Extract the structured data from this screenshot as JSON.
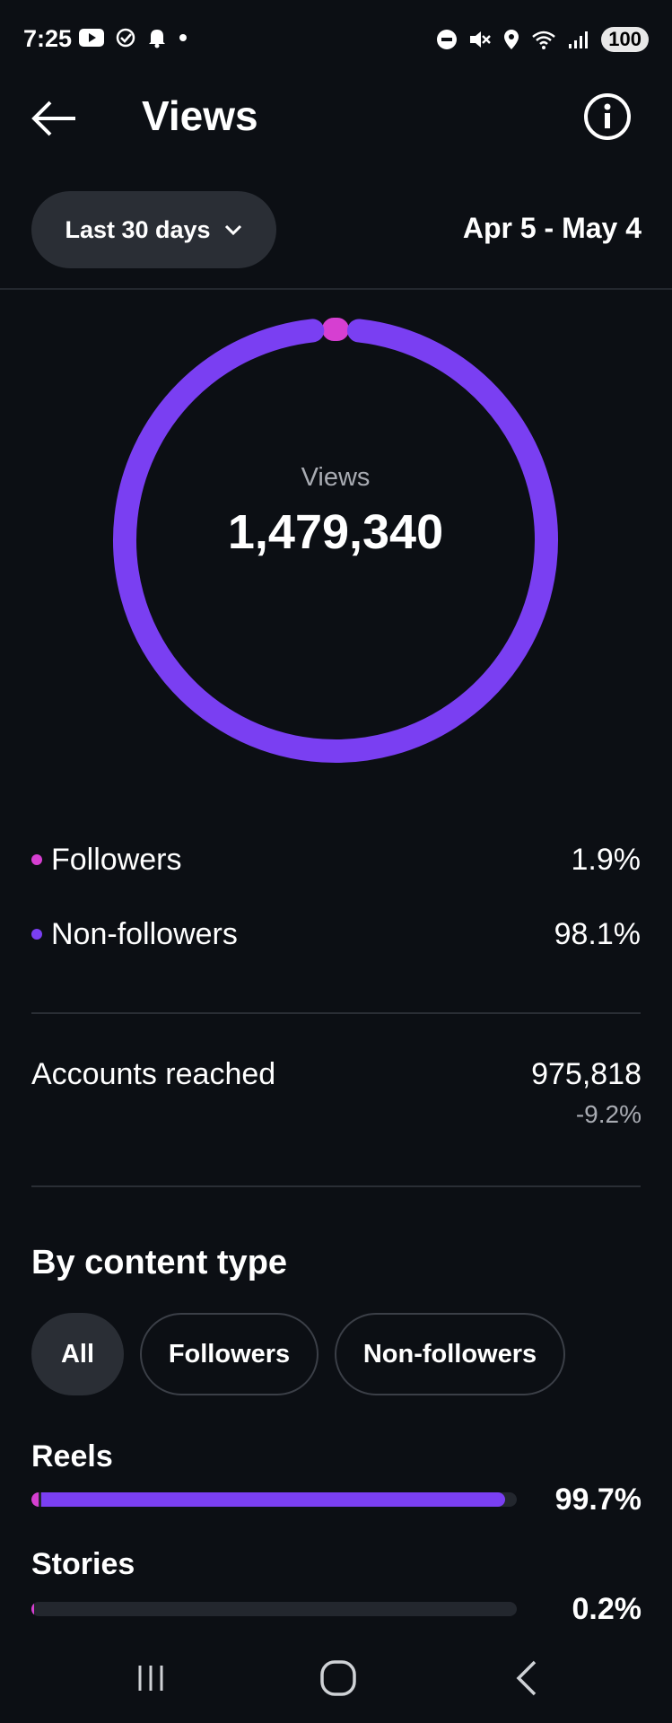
{
  "status_bar": {
    "time": "7:25",
    "battery": "100"
  },
  "header": {
    "title": "Views"
  },
  "filter": {
    "range_label": "Last 30 days",
    "date_range": "Apr 5 - May 4"
  },
  "summary": {
    "label": "Views",
    "total": "1,479,340",
    "segments": [
      {
        "name": "Followers",
        "pct_text": "1.9%",
        "fraction": 0.019,
        "color": "#d63fd1"
      },
      {
        "name": "Non-followers",
        "pct_text": "98.1%",
        "fraction": 0.981,
        "color": "#7a3ff2"
      }
    ]
  },
  "reach": {
    "label": "Accounts reached",
    "value": "975,818",
    "delta": "-9.2%"
  },
  "content_type": {
    "title": "By content type",
    "tabs": [
      "All",
      "Followers",
      "Non-followers"
    ],
    "active_tab": "All",
    "rows": [
      {
        "label": "Reels",
        "pct_text": "99.7%",
        "total_fraction": 0.997,
        "follower_fraction": 0.019
      },
      {
        "label": "Stories",
        "pct_text": "0.2%",
        "total_fraction": 0.002,
        "follower_fraction": 0.002
      }
    ]
  },
  "colors": {
    "background": "#0c0f14",
    "followers": "#d63fd1",
    "non_followers": "#7a3ff2"
  }
}
